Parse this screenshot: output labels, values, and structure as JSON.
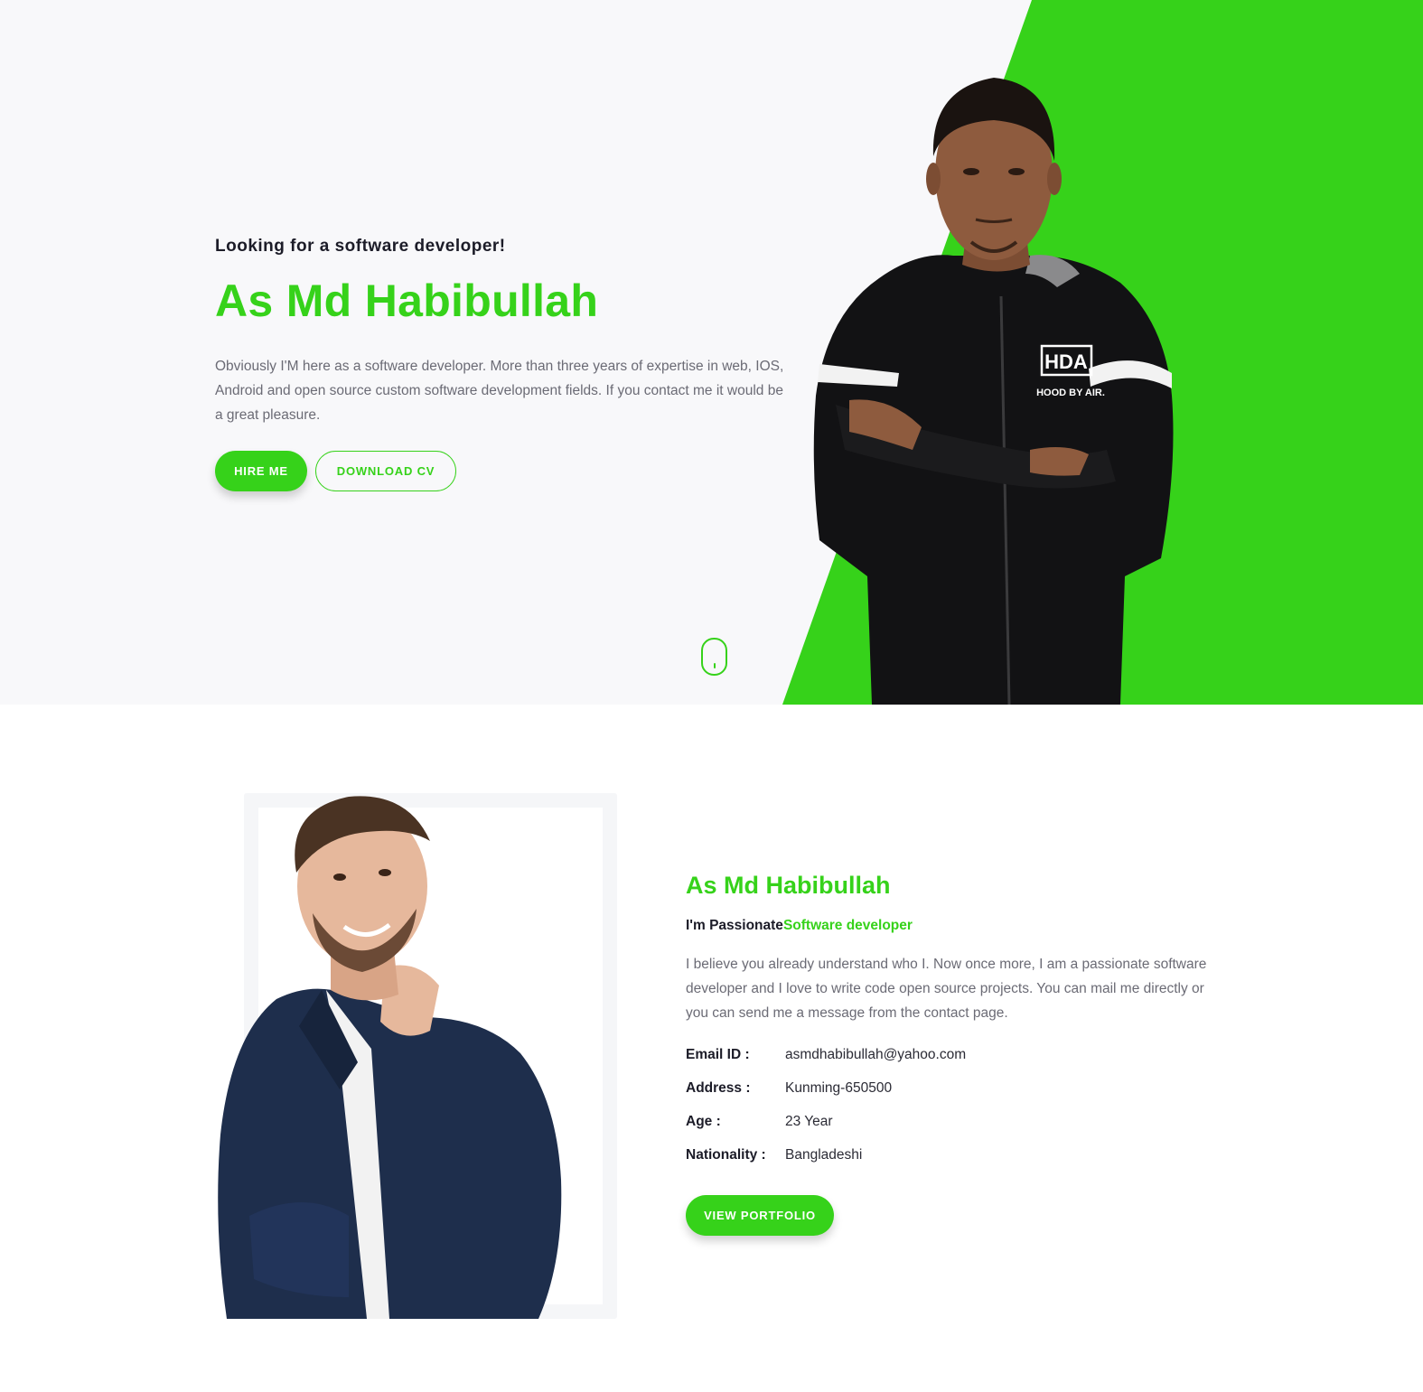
{
  "colors": {
    "accent": "#36d21a",
    "hero_bg": "#f8f8fa",
    "heading": "#1c1c28",
    "muted": "#6b6b75"
  },
  "hero": {
    "eyebrow": "Looking for a software developer!",
    "title": "As Md Habibullah",
    "description": "Obviously I'M here as a software developer. More than three years of expertise in web, IOS, Android and open source custom software development fields. If you contact me it would be a great pleasure.",
    "hire_label": "HIRE ME",
    "cv_label": "DOWNLOAD CV",
    "jacket_text": "HDA",
    "jacket_subtext": "HOOD BY AIR."
  },
  "about": {
    "title": "As Md Habibullah",
    "subtitle_prefix": "I'm Passionate",
    "subtitle_accent": "Software developer",
    "description": "I believe you already understand who I. Now once more, I am a passionate software developer and I love to write code open source projects. You can mail me directly or you can send me a message from the contact page.",
    "info": [
      {
        "label": "Email ID :",
        "value": "asmdhabibullah@yahoo.com"
      },
      {
        "label": "Address :",
        "value": "Kunming-650500"
      },
      {
        "label": "Age :",
        "value": "23 Year"
      },
      {
        "label": "Nationality :",
        "value": "Bangladeshi"
      }
    ],
    "portfolio_label": "VIEW PORTFOLIO"
  }
}
